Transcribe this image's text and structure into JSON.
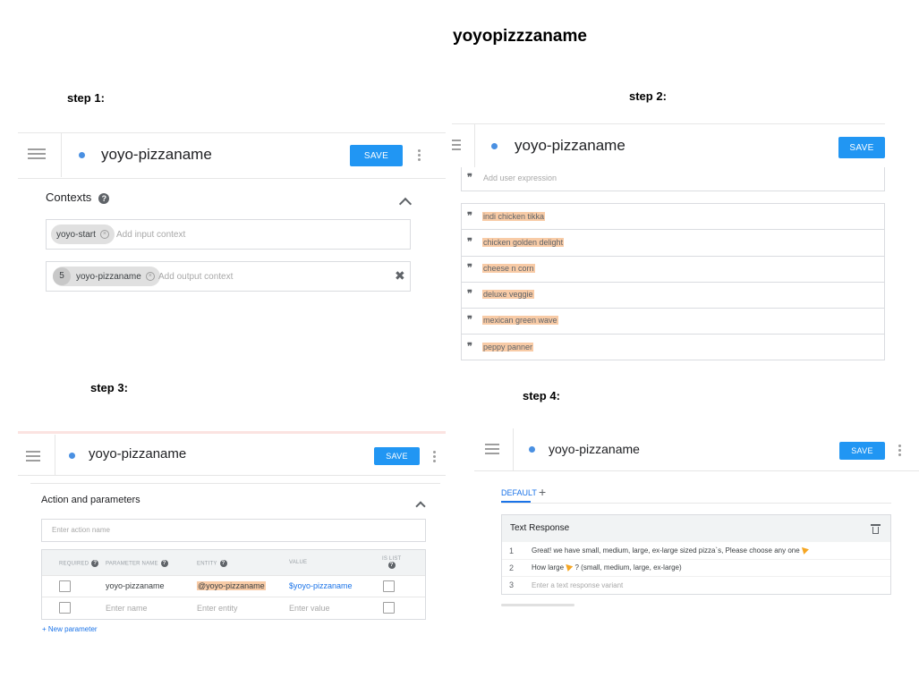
{
  "main_title": "yoyopizzzaname",
  "steps": {
    "s1": "step 1:",
    "s2": "step 2:",
    "s3": "step 3:",
    "s4": "step 4:"
  },
  "intent_name": "yoyo-pizzaname",
  "save_label": "SAVE",
  "step1": {
    "contexts_title": "Contexts",
    "input_chip": "yoyo-start",
    "input_placeholder": "Add input context",
    "output_lifespan": "5",
    "output_chip": "yoyo-pizzaname",
    "output_placeholder": "Add output context"
  },
  "step2": {
    "add_expression_placeholder": "Add user expression",
    "expressions": [
      "indi chicken tikka",
      "chicken golden delight",
      "cheese n corn",
      "deluxe veggie",
      "mexican green wave",
      "peppy panner"
    ]
  },
  "step3": {
    "section_title": "Action and parameters",
    "action_placeholder": "Enter action name",
    "headers": {
      "required": "REQUIRED",
      "parameter_name": "PARAMETER NAME",
      "entity": "ENTITY",
      "value": "VALUE",
      "is_list": "IS LIST"
    },
    "row": {
      "name": "yoyo-pizzaname",
      "entity": "@yoyo-pizzaname",
      "value": "$yoyo-pizzaname"
    },
    "empty_row": {
      "name": "Enter name",
      "entity": "Enter entity",
      "value": "Enter value"
    },
    "new_parameter": "+ New parameter"
  },
  "step4": {
    "tab_default": "DEFAULT",
    "tab_add": "+",
    "card_title": "Text Response",
    "responses": [
      {
        "num": "1",
        "text": "Great! we have  small,  medium, large, ex-large sized pizza`s, Please choose any one"
      },
      {
        "num": "2",
        "text": "How large"
      },
      {
        "num": "3",
        "text": "Enter a text response variant"
      }
    ],
    "response2_suffix": "? (small, medium, large, ex-large)"
  },
  "icons": {
    "menu": "hamburger-menu-icon",
    "more": "more-vert-icon",
    "help": "help-icon",
    "collapse": "chevron-up-icon",
    "chip_remove": "close-circle-icon",
    "clear": "close-icon",
    "quote": "quote-icon",
    "delete": "trash-icon",
    "pizza": "pizza-emoji-icon"
  },
  "colors": {
    "accent": "#2196f3",
    "highlight": "#f8cba6",
    "dot": "#4a90e2"
  }
}
